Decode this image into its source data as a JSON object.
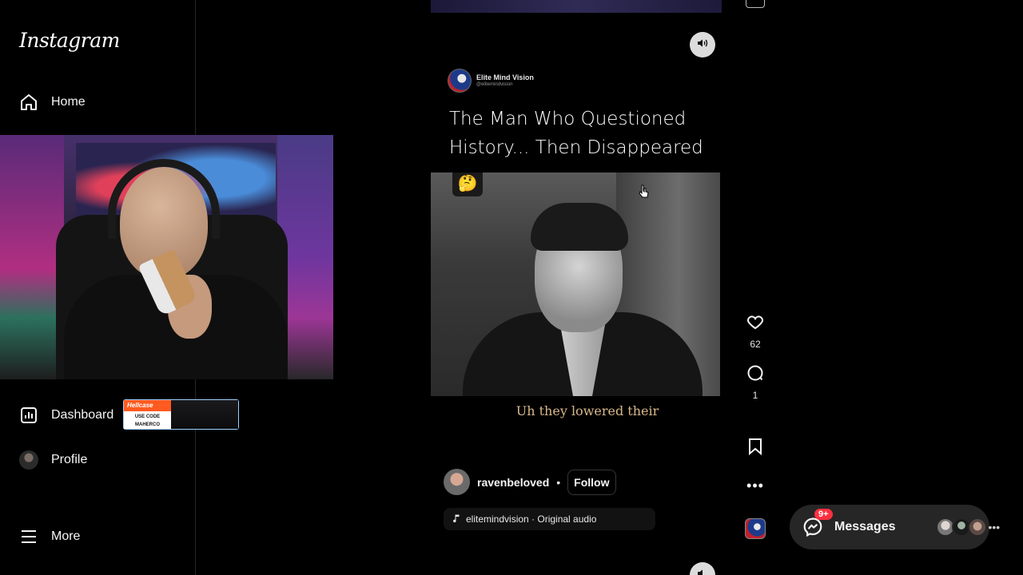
{
  "app": {
    "logo": "Instagram"
  },
  "sidebar": {
    "items": [
      {
        "label": "Home",
        "icon": "home-icon"
      },
      {
        "label": "Dashboard",
        "icon": "dashboard-icon"
      },
      {
        "label": "Profile",
        "icon": "avatar"
      },
      {
        "label": "More",
        "icon": "menu-icon"
      }
    ]
  },
  "sponsor": {
    "brand": "Hellcase",
    "code_label": "USE CODE",
    "code": "MAHERCO"
  },
  "reel": {
    "channel_name": "Elite Mind Vision",
    "channel_handle": "@elitemindvision",
    "title": "The Man Who Questioned History... Then Disappeared",
    "emoji": "🤔",
    "caption": "Uh they lowered their",
    "author": "ravenbeloved",
    "follow_label": "Follow",
    "audio": "elitemindvision · Original audio"
  },
  "actions": {
    "likes": "62",
    "comments": "1"
  },
  "messages": {
    "label": "Messages",
    "badge": "9+"
  },
  "colors": {
    "background": "#000000",
    "caption": "#d8b98a",
    "badge": "#ff3040",
    "sponsor_border": "#9fd1ff"
  }
}
